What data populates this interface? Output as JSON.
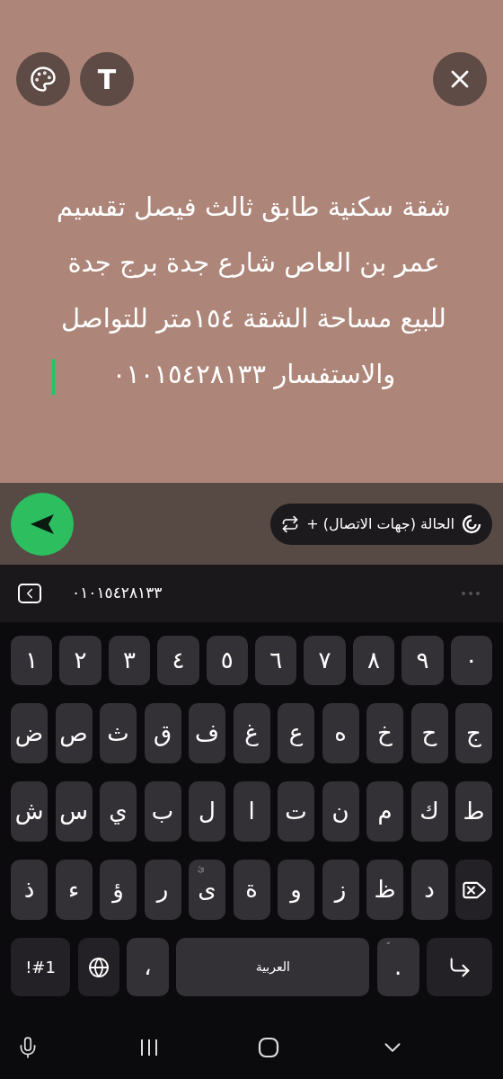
{
  "top_bar": {
    "text_button": "T"
  },
  "status_text": {
    "lines": [
      "شقة سكنية طابق ثالث فيصل تقسيم",
      "عمر بن العاص شارع جدة برج جدة",
      "للبيع مساحة الشقة ١٥٤متر للتواصل",
      "والاستفسار ٠١٠١٥٤٢٨١٣٣"
    ]
  },
  "audience_chip": {
    "label": "الحالة (جهات الاتصال) +"
  },
  "suggestion_bar": {
    "suggestion": "٠١٠١٥٤٢٨١٣٣"
  },
  "keyboard": {
    "rows": [
      {
        "keys": [
          {
            "kind": "char",
            "label": "٠"
          },
          {
            "kind": "char",
            "label": "٩"
          },
          {
            "kind": "char",
            "label": "٨"
          },
          {
            "kind": "char",
            "label": "٧"
          },
          {
            "kind": "char",
            "label": "٦"
          },
          {
            "kind": "char",
            "label": "٥"
          },
          {
            "kind": "char",
            "label": "٤"
          },
          {
            "kind": "char",
            "label": "٣"
          },
          {
            "kind": "char",
            "label": "٢"
          },
          {
            "kind": "char",
            "label": "١"
          }
        ]
      },
      {
        "keys": [
          {
            "kind": "char",
            "label": "ج"
          },
          {
            "kind": "char",
            "label": "ح"
          },
          {
            "kind": "char",
            "label": "خ"
          },
          {
            "kind": "char",
            "label": "ه"
          },
          {
            "kind": "char",
            "label": "ع"
          },
          {
            "kind": "char",
            "label": "غ"
          },
          {
            "kind": "char",
            "label": "ف"
          },
          {
            "kind": "char",
            "label": "ق"
          },
          {
            "kind": "char",
            "label": "ث"
          },
          {
            "kind": "char",
            "label": "ص"
          },
          {
            "kind": "char",
            "label": "ض"
          }
        ]
      },
      {
        "keys": [
          {
            "kind": "char",
            "label": "ط"
          },
          {
            "kind": "char",
            "label": "ك"
          },
          {
            "kind": "char",
            "label": "م"
          },
          {
            "kind": "char",
            "label": "ن"
          },
          {
            "kind": "char",
            "label": "ت"
          },
          {
            "kind": "char",
            "label": "ا"
          },
          {
            "kind": "char",
            "label": "ل"
          },
          {
            "kind": "char",
            "label": "ب"
          },
          {
            "kind": "char",
            "label": "ي"
          },
          {
            "kind": "char",
            "label": "س"
          },
          {
            "kind": "char",
            "label": "ش"
          }
        ]
      },
      {
        "keys": [
          {
            "kind": "backspace"
          },
          {
            "kind": "char",
            "label": "د"
          },
          {
            "kind": "char",
            "label": "ظ"
          },
          {
            "kind": "char",
            "label": "ز"
          },
          {
            "kind": "char",
            "label": "و"
          },
          {
            "kind": "char",
            "label": "ة"
          },
          {
            "kind": "char",
            "label": "ى",
            "hint": "ئ"
          },
          {
            "kind": "char",
            "label": "ر"
          },
          {
            "kind": "char",
            "label": "ؤ"
          },
          {
            "kind": "char",
            "label": "ء"
          },
          {
            "kind": "char",
            "label": "ذ"
          }
        ]
      },
      {
        "keys": [
          {
            "kind": "enter"
          },
          {
            "kind": "char",
            "label": ".",
            "hint": "ّ"
          },
          {
            "kind": "space",
            "label": "العربية"
          },
          {
            "kind": "char",
            "label": "،"
          },
          {
            "kind": "globe"
          },
          {
            "kind": "symbols",
            "label": "!#1"
          }
        ]
      }
    ]
  }
}
